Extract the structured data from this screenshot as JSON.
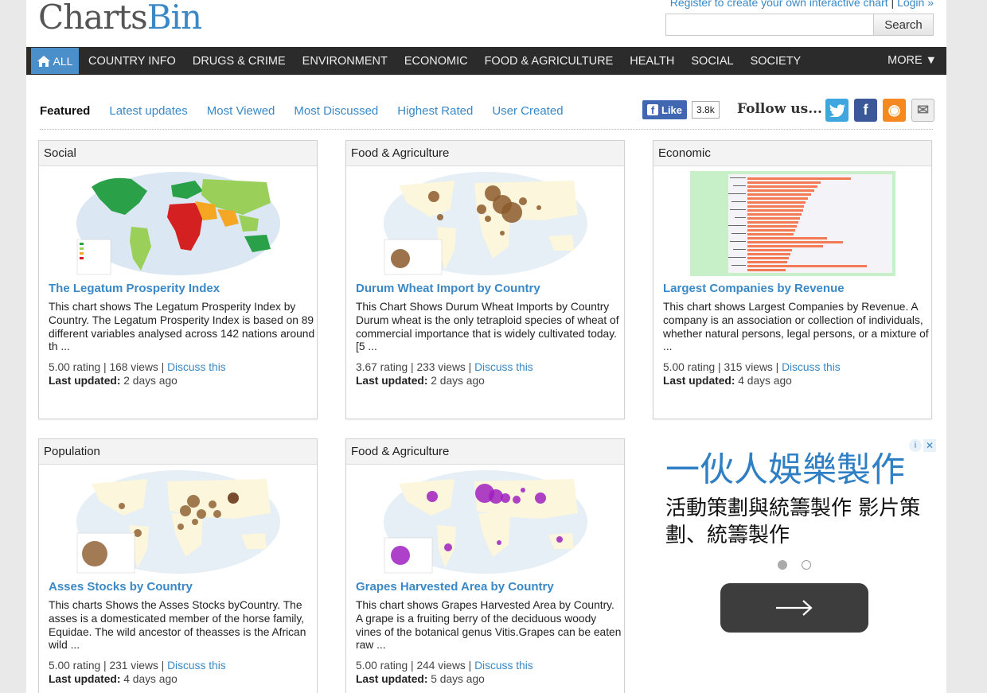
{
  "header": {
    "logo_part1": "Charts",
    "logo_part2": "Bin",
    "register_link": "Register to create your own interactive chart",
    "login_link": "Login »",
    "search_placeholder": "",
    "search_button": "Search"
  },
  "nav": {
    "all_label": "ALL",
    "items": [
      "COUNTRY INFO",
      "DRUGS & CRIME",
      "ENVIRONMENT",
      "ECONOMIC",
      "FOOD & AGRICULTURE",
      "HEALTH",
      "SOCIAL",
      "SOCIETY"
    ],
    "more_label": "MORE ▼"
  },
  "tabs": [
    "Featured",
    "Latest updates",
    "Most Viewed",
    "Most Discussed",
    "Highest Rated",
    "User Created"
  ],
  "social": {
    "like_label": "Like",
    "like_count": "3.8k",
    "follow_label": "Follow us...",
    "fb_glyph": "f",
    "rss_glyph": "◉",
    "mail_glyph": "✉"
  },
  "labels": {
    "discuss": "Discuss this",
    "last_updated": "Last updated:"
  },
  "cards": [
    {
      "category": "Social",
      "title": "The Legatum Prosperity Index",
      "description": "This chart shows The Legatum Prosperity Index by Country. The Legatum Prosperity Index is based on 89 different variables analysed across 142 nations around th ...",
      "stats": "5.00 rating | 168 views |",
      "updated": "2 days ago"
    },
    {
      "category": "Food & Agriculture",
      "title": "Durum Wheat Import by Country",
      "description": "This Chart Shows Durum Wheat Imports by Country Durum wheat is the only tetraploid species of wheat of commercial importance that is widely cultivated today.[5 ...",
      "stats": "3.67 rating | 233 views |",
      "updated": "2 days ago"
    },
    {
      "category": "Economic",
      "title": "Largest Companies by Revenue",
      "description": "This chart shows Largest Companies by Revenue. A company is an association or collection of individuals, whether natural persons, legal persons, or a mixture of ...",
      "stats": "5.00 rating | 315 views |",
      "updated": "4 days ago"
    },
    {
      "category": "Population",
      "title": "Asses Stocks by Country",
      "description": "This charts Shows the Asses Stocks byCountry. The asses is a domesticated member of the horse family, Equidae. The wild ancestor of theasses is the African wild ...",
      "stats": "5.00 rating | 231 views |",
      "updated": "4 days ago"
    },
    {
      "category": "Food & Agriculture",
      "title": "Grapes Harvested Area by Country",
      "description": "This chart shows Grapes Harvested Area by Country. A grape is a fruiting berry of the deciduous woody vines of the botanical genus Vitis.Grapes can be eaten raw ...",
      "stats": "5.00 rating | 244 views |",
      "updated": "5 days ago"
    }
  ],
  "ad": {
    "headline": "一伙人娛樂製作",
    "subtext": "活動策劃與統籌製作 影片策劃、統籌製作",
    "info_glyph": "i",
    "close_glyph": "✕",
    "arrow_icon": "arrow-right-icon"
  },
  "colors": {
    "accent": "#3a88c5",
    "nav_bg": "#2b2b2b",
    "nav_active": "#4a8fc9",
    "map_green": "#2aa048",
    "map_red": "#d42020",
    "wheat_bubble": "#8b5a2b",
    "grape_bubble": "#a020c0",
    "bar_orange": "#f47a55",
    "ad_blue": "#2f7fc4"
  }
}
